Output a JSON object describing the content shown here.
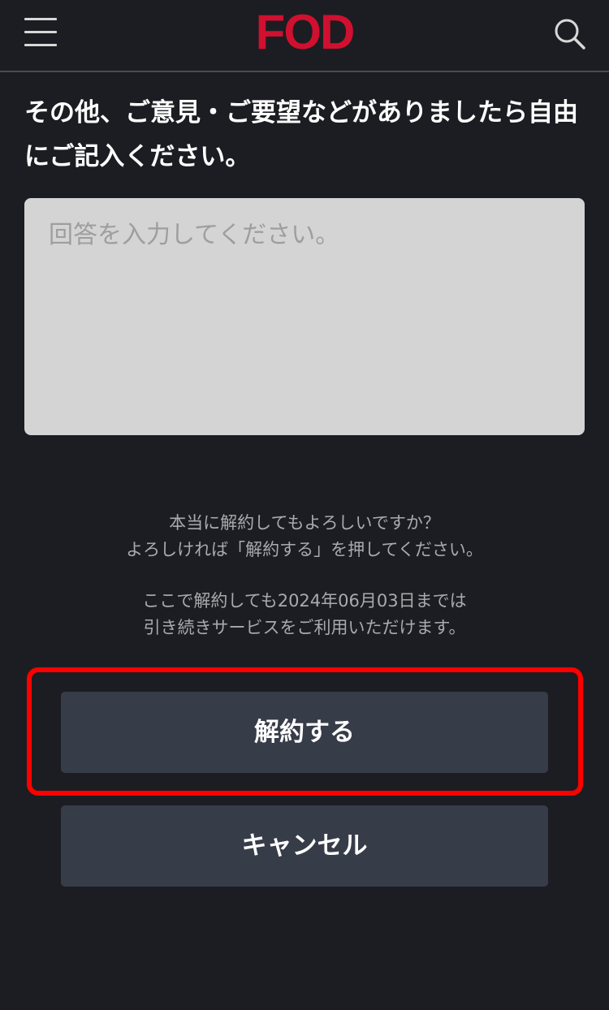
{
  "header": {
    "logo_text": "FOD",
    "logo_color": "#d0102f",
    "menu_icon": "hamburger-menu-icon",
    "search_icon": "search-icon"
  },
  "form": {
    "question": "その他、ご意見・ご要望などがありましたら自由にご記入ください。",
    "answer_placeholder": "回答を入力してください。",
    "answer_value": ""
  },
  "notice": {
    "confirm_line1": "本当に解約してもよろしいですか？",
    "confirm_line2": "よろしければ「解約する」を押してください。",
    "until_line1": "ここで解約しても2024年06月03日までは",
    "until_line2": "引き続きサービスをご利用いただけます。"
  },
  "actions": {
    "unsubscribe_label": "解約する",
    "cancel_label": "キャンセル"
  },
  "colors": {
    "background": "#1c1d22",
    "button": "#373c49",
    "highlight": "#ff0000",
    "input_bg": "#d4d4d4"
  }
}
